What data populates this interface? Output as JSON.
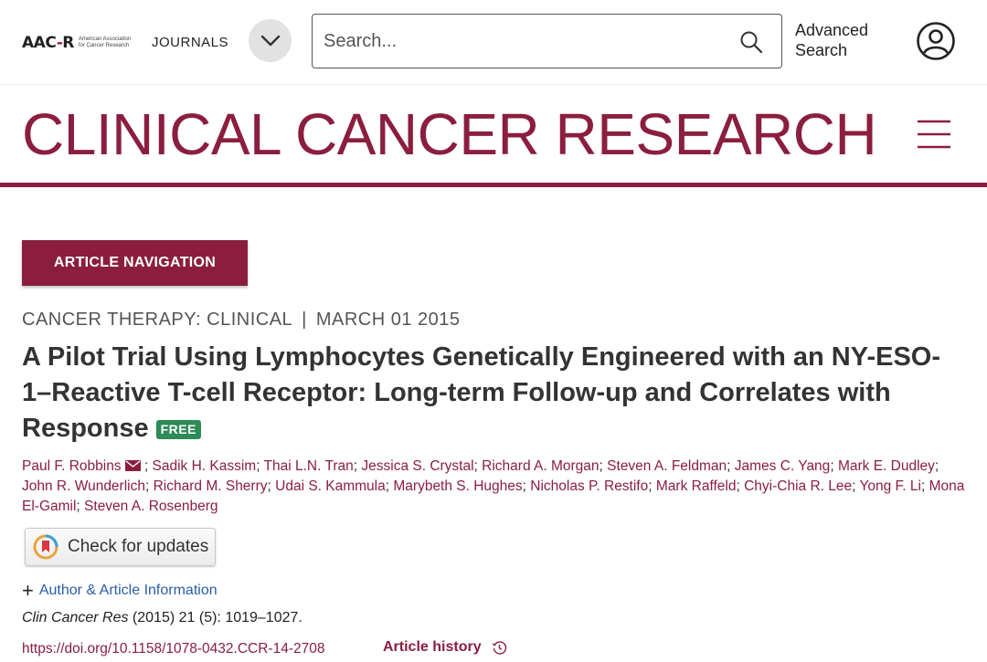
{
  "header": {
    "logo_mark_left": "AAC",
    "logo_mark_right": "R",
    "logo_org_line1": "American Association",
    "logo_org_line2": "for Cancer Research",
    "logo_journals": "JOURNALS",
    "search_placeholder": "Search...",
    "advanced_search_line1": "Advanced",
    "advanced_search_line2": "Search"
  },
  "banner": {
    "journal_title": "CLINICAL CANCER RESEARCH"
  },
  "article": {
    "nav_button": "ARTICLE NAVIGATION",
    "category": "CANCER THERAPY: CLINICAL",
    "category_sep": "|",
    "date": "MARCH 01 2015",
    "title": "A Pilot Trial Using Lymphocytes Genetically Engineered with an NY-ESO-1–Reactive T-cell Receptor: Long-term Follow-up and Correlates with Response",
    "free_badge": "FREE",
    "authors": [
      "Paul F. Robbins",
      "Sadik H. Kassim",
      "Thai L.N. Tran",
      "Jessica S. Crystal",
      "Richard A. Morgan",
      "Steven A. Feldman",
      "James C. Yang",
      "Mark E. Dudley",
      "John R. Wunderlich",
      "Richard M. Sherry",
      "Udai S. Kammula",
      "Marybeth S. Hughes",
      "Nicholas P. Restifo",
      "Mark Raffeld",
      "Chyi-Chia R. Lee",
      "Yong F. Li",
      "Mona El-Gamil",
      "Steven A. Rosenberg"
    ],
    "check_updates": "Check for updates",
    "author_info": "Author & Article Information",
    "citation_journal": "Clin Cancer Res",
    "citation_rest": " (2015) 21 (5): 1019–1027.",
    "doi": "https://doi.org/10.1158/1078-0432.CCR-14-2708",
    "history": "Article history"
  },
  "colors": {
    "brand": "#8b1e3f",
    "link_blue": "#2a5ea8",
    "free_green": "#2e8b57"
  }
}
